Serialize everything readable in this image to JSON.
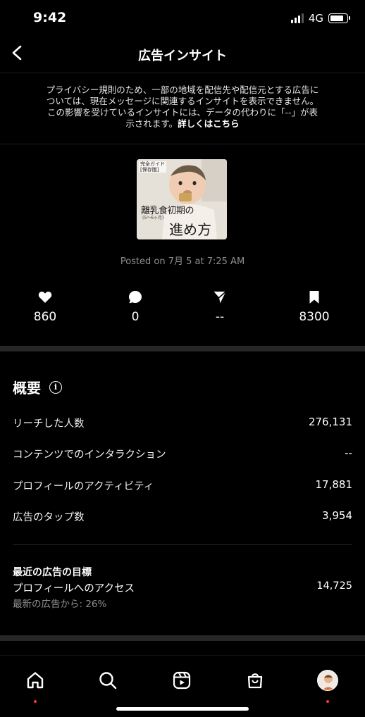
{
  "status_bar": {
    "time": "9:42",
    "network": "4G"
  },
  "header": {
    "title": "広告インサイト"
  },
  "notice": {
    "line1": "プライバシー規則のため、一部の地域を配信先や配信元とする広告に",
    "line2": "ついては、現在メッセージに関連するインサイトを表示できません。",
    "line3": "この影響を受けているインサイトには、データの代わりに「--」が表",
    "line4_prefix": "示されます。",
    "link": "詳しくはこちら"
  },
  "post": {
    "thumb_tag1": "完全ガイド",
    "thumb_tag2": "[保存版]",
    "thumb_title1": "離乳食初期の",
    "thumb_sub": "(5〜6ヶ月)",
    "thumb_title2": "進め方",
    "posted_on": "Posted on 7月 5 at 7:25 AM"
  },
  "metrics": {
    "likes": "860",
    "comments": "0",
    "shares": "--",
    "saves": "8300"
  },
  "overview": {
    "title": "概要",
    "rows": [
      {
        "label": "リーチした人数",
        "value": "276,131"
      },
      {
        "label": "コンテンツでのインタラクション",
        "value": "--"
      },
      {
        "label": "プロフィールのアクティビティ",
        "value": "17,881"
      },
      {
        "label": "広告のタップ数",
        "value": "3,954"
      }
    ],
    "goal": {
      "heading": "最近の広告の目標",
      "label": "プロフィールへのアクセス",
      "value": "14,725",
      "sub": "最新の広告から: 26%"
    }
  },
  "icons": {
    "back": "chevron-left-icon",
    "like": "heart-icon",
    "comment": "comment-bubble-icon",
    "share": "send-icon",
    "save": "bookmark-icon",
    "tabs": [
      "home-icon",
      "search-icon",
      "reels-icon",
      "shop-icon",
      "profile-avatar"
    ]
  },
  "colors": {
    "background": "#000000",
    "secondary_text": "#8e8e8e",
    "notification_dot": "#ff3040"
  }
}
